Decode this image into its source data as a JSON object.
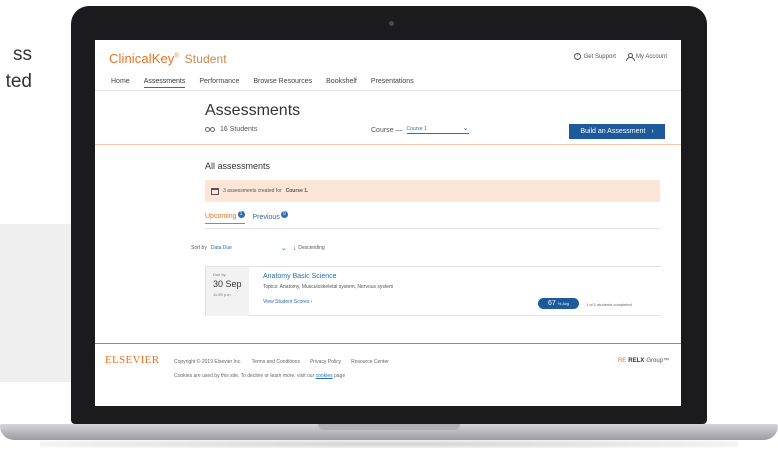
{
  "background": {
    "text_line_1": "ss",
    "text_line_2": "ted"
  },
  "app": {
    "brand": "ClinicalKey",
    "brand_mark": "®",
    "brand_product": "Student",
    "header": {
      "support_label": "Get Support",
      "account_label": "My Account"
    },
    "nav": {
      "tabs": [
        "Home",
        "Assessments",
        "Performance",
        "Browse Resources",
        "Bookshelf",
        "Presentations"
      ],
      "active": "Assessments"
    },
    "page_title": "Assessments",
    "students_label": "16 Students",
    "course_label": "Course —",
    "course_value": "Course 1",
    "build_button_label": "Build an Assessment",
    "section_title": "All assessments",
    "notice_prefix": "3 assessments created for",
    "notice_course": "Course 1.",
    "subtabs": {
      "upcoming_label": "Upcoming",
      "upcoming_count": "1",
      "previous_label": "Previous",
      "previous_count": "0"
    },
    "sort": {
      "label": "Sort by",
      "value": "Data Due",
      "direction": "Descending"
    },
    "assessment": {
      "due_label": "Due by",
      "due_date": "30 Sep",
      "due_time": "11:59 p.m.",
      "name": "Anatomy Basic Science",
      "topics": "Topics: Anatomy, Musculoskeletal system, Nervous system",
      "view_link": "View Student Scores",
      "percent_value": "67",
      "percent_unit": "% Avg",
      "completed": "1 of 1 students completed"
    },
    "footer": {
      "logo": "ELSEVIER",
      "copyright": "Copyright © 2019 Elsevier Inc.",
      "terms": "Terms and Conditions",
      "privacy": "Privacy Policy",
      "resource": "Resource Center",
      "cookies_text": "Cookies are used by this site. To decline or learn more, visit our",
      "cookies_link": "cookies",
      "cookies_suffix": "page",
      "relx_mark": "RE",
      "relx_name": "RELX",
      "relx_suffix": "Group™"
    },
    "colors": {
      "brand_orange": "#e9711c",
      "primary_blue": "#1e5a9b",
      "link_blue": "#2a6db3",
      "notice_bg": "#fbe6d8"
    }
  }
}
